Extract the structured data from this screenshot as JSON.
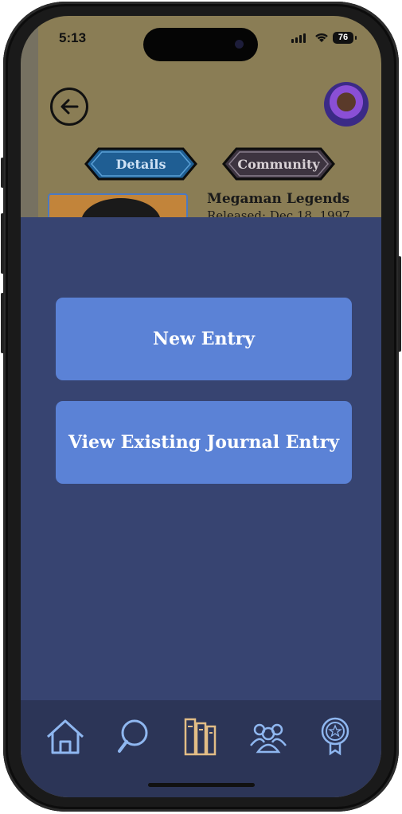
{
  "status_bar": {
    "time": "5:13",
    "battery": "76"
  },
  "header": {
    "tabs": [
      {
        "label": "Details"
      },
      {
        "label": "Community"
      }
    ]
  },
  "game": {
    "title": "Megaman Legends",
    "released": "Released: Dec 18, 1997"
  },
  "sheet": {
    "new_entry_label": "New Entry",
    "view_existing_label": "View Existing Journal Entry"
  },
  "bottom_nav": [
    {
      "icon": "home-icon"
    },
    {
      "icon": "search-icon"
    },
    {
      "icon": "library-icon"
    },
    {
      "icon": "community-icon"
    },
    {
      "icon": "achievement-badge-icon"
    }
  ],
  "colors": {
    "sheet_bg": "#374471",
    "button_bg": "#5b82d6",
    "nav_bg": "#2c3557",
    "active_nav": "#e2bd86",
    "inactive_nav": "#8fb7f0"
  }
}
